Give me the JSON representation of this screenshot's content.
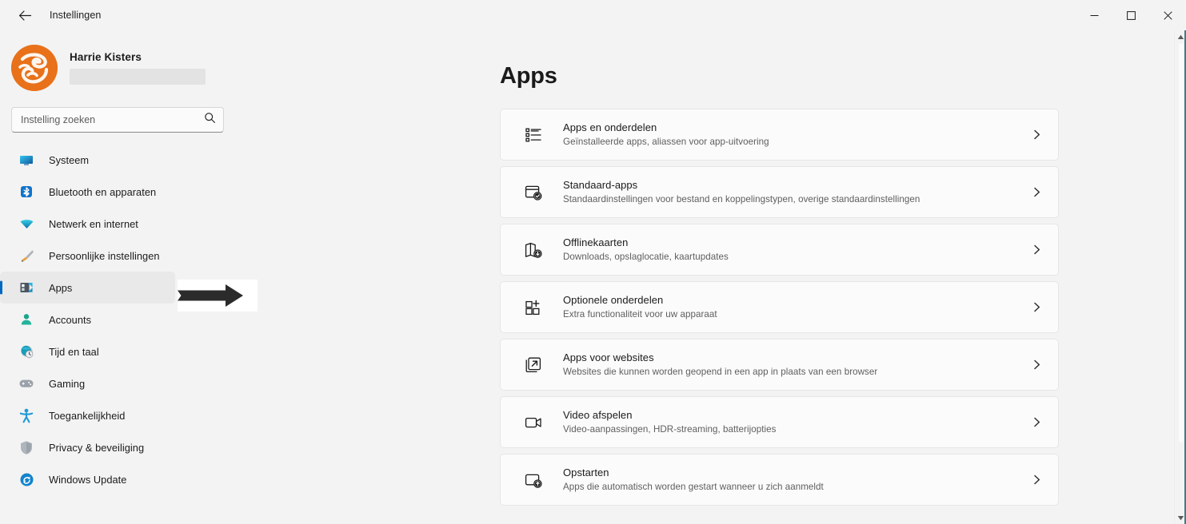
{
  "window": {
    "title": "Instellingen",
    "back_icon": "back-arrow-icon",
    "minimize_label": "—",
    "maximize_label": "□",
    "close_label": "✕"
  },
  "sidebar": {
    "profile": {
      "name": "Harrie Kisters",
      "avatar_icon": "user-avatar-logo",
      "email_redacted": ""
    },
    "search": {
      "placeholder": "Instelling zoeken",
      "value": "",
      "icon": "search-icon"
    },
    "items": [
      {
        "label": "Systeem",
        "icon": "monitor-icon",
        "active": false
      },
      {
        "label": "Bluetooth en apparaten",
        "icon": "bluetooth-icon",
        "active": false
      },
      {
        "label": "Netwerk en internet",
        "icon": "wifi-icon",
        "active": false
      },
      {
        "label": "Persoonlijke instellingen",
        "icon": "paintbrush-icon",
        "active": false
      },
      {
        "label": "Apps",
        "icon": "apps-icon",
        "active": true
      },
      {
        "label": "Accounts",
        "icon": "person-icon",
        "active": false
      },
      {
        "label": "Tijd en taal",
        "icon": "clock-globe-icon",
        "active": false
      },
      {
        "label": "Gaming",
        "icon": "gamepad-icon",
        "active": false
      },
      {
        "label": "Toegankelijkheid",
        "icon": "accessibility-icon",
        "active": false
      },
      {
        "label": "Privacy & beveiliging",
        "icon": "shield-icon",
        "active": false
      },
      {
        "label": "Windows Update",
        "icon": "update-icon",
        "active": false
      }
    ]
  },
  "main": {
    "page_title": "Apps",
    "cards": [
      {
        "title": "Apps en onderdelen",
        "subtitle": "Geïnstalleerde apps, aliassen voor app-uitvoering",
        "icon": "app-list-icon",
        "chevron": "chevron-right-icon"
      },
      {
        "title": "Standaard-apps",
        "subtitle": "Standaardinstellingen voor bestand en koppelingstypen, overige standaardinstellingen",
        "icon": "default-apps-icon",
        "chevron": "chevron-right-icon"
      },
      {
        "title": "Offlinekaarten",
        "subtitle": "Downloads, opslaglocatie, kaartupdates",
        "icon": "offline-maps-icon",
        "chevron": "chevron-right-icon"
      },
      {
        "title": "Optionele onderdelen",
        "subtitle": "Extra functionaliteit voor uw apparaat",
        "icon": "optional-features-icon",
        "chevron": "chevron-right-icon"
      },
      {
        "title": "Apps voor websites",
        "subtitle": "Websites die kunnen worden geopend in een app in plaats van een browser",
        "icon": "apps-for-websites-icon",
        "chevron": "chevron-right-icon"
      },
      {
        "title": "Video afspelen",
        "subtitle": "Video-aanpassingen, HDR-streaming, batterijopties",
        "icon": "video-playback-icon",
        "chevron": "chevron-right-icon"
      },
      {
        "title": "Opstarten",
        "subtitle": "Apps die automatisch worden gestart wanneer u zich aanmeldt",
        "icon": "startup-icon",
        "chevron": "chevron-right-icon"
      }
    ]
  },
  "annotation": {
    "arrow_icon": "pointer-arrow-icon",
    "points_to": "Apps"
  },
  "scrollbar": {
    "up_icon": "scroll-up-arrow-icon",
    "down_icon": "scroll-down-arrow-icon"
  },
  "colors": {
    "accent": "#0067c0",
    "page_background": "#f3f3f3",
    "card_background": "#fbfbfb",
    "card_border": "#e6e6e6",
    "avatar_orange": "#e8711a",
    "text_primary": "#1b1b1b",
    "text_secondary": "#5e5e5e",
    "close_hover": "#c42b1c"
  }
}
